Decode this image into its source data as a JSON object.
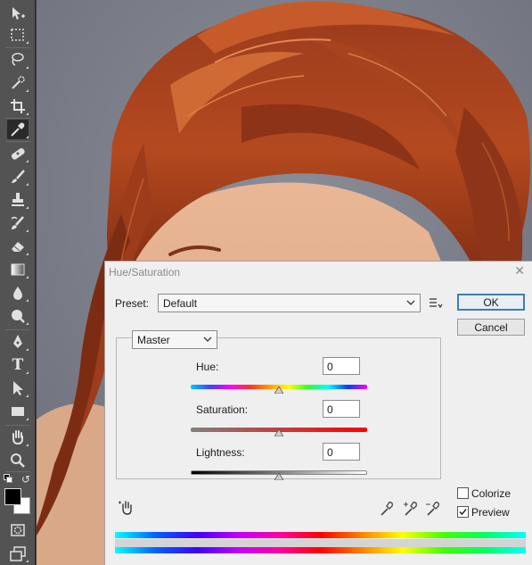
{
  "dialog": {
    "title": "Hue/Saturation",
    "close_glyph": "✕",
    "preset_label": "Preset:",
    "preset_value": "Default",
    "preset_options_icon": "preset-options-icon",
    "ok_label": "OK",
    "cancel_label": "Cancel",
    "channel_value": "Master",
    "hue": {
      "label": "Hue:",
      "value": "0"
    },
    "saturation": {
      "label": "Saturation:",
      "value": "0"
    },
    "lightness": {
      "label": "Lightness:",
      "value": "0"
    },
    "colorize_label": "Colorize",
    "colorize_checked": false,
    "preview_label": "Preview",
    "preview_checked": true,
    "icons": [
      "on-image-adjust-hand-icon",
      "eyedropper-icon",
      "eyedropper-plus-icon",
      "eyedropper-minus-icon"
    ]
  },
  "toolbar": {
    "tools": [
      {
        "name": "move-tool-icon",
        "glyph": "✥"
      },
      {
        "name": "marquee-tool-icon",
        "glyph": "⬚"
      },
      {
        "name": "lasso-tool-icon",
        "glyph": "ʘ"
      },
      {
        "name": "quick-selection-tool-icon",
        "glyph": "✎"
      },
      {
        "name": "crop-tool-icon",
        "glyph": "⌗"
      },
      {
        "name": "eyedropper-tool-icon",
        "glyph": "✐"
      },
      {
        "name": "healing-brush-tool-icon",
        "glyph": "✚"
      },
      {
        "name": "brush-tool-icon",
        "glyph": "✏"
      },
      {
        "name": "clone-stamp-tool-icon",
        "glyph": "⊥"
      },
      {
        "name": "history-brush-tool-icon",
        "glyph": "✍"
      },
      {
        "name": "eraser-tool-icon",
        "glyph": "◪"
      },
      {
        "name": "gradient-tool-icon",
        "glyph": "▤"
      },
      {
        "name": "blur-tool-icon",
        "glyph": "●"
      },
      {
        "name": "dodge-tool-icon",
        "glyph": "◕"
      },
      {
        "name": "pen-tool-icon",
        "glyph": "✒"
      },
      {
        "name": "type-tool-icon",
        "glyph": "T"
      },
      {
        "name": "path-selection-tool-icon",
        "glyph": "➤"
      },
      {
        "name": "rectangle-tool-icon",
        "glyph": "▭"
      },
      {
        "name": "hand-tool-icon",
        "glyph": "✋"
      },
      {
        "name": "zoom-tool-icon",
        "glyph": "⚲"
      }
    ],
    "foreground_color": "#000000",
    "background_color": "#ffffff"
  }
}
